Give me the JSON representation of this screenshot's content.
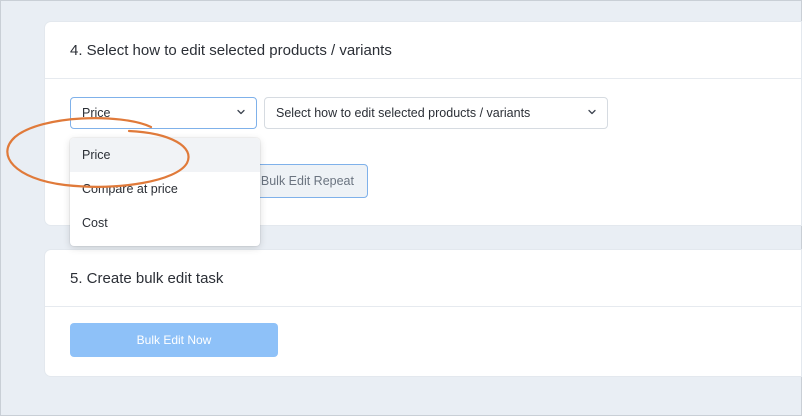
{
  "step4": {
    "title": "4. Select how to edit selected products / variants",
    "field_select_value": "Price",
    "mode_select_placeholder": "Select how to edit selected products / variants",
    "repeat_button_label": "e Bulk Edit Repeat",
    "dropdown_options": [
      "Price",
      "Compare at price",
      "Cost"
    ],
    "dropdown_selected_index": 0
  },
  "step5": {
    "title": "5. Create bulk edit task",
    "bulk_edit_button_label": "Bulk Edit Now"
  },
  "annotation": {
    "ring_color": "#e07a3a",
    "shape": "ellipse-highlight"
  },
  "colors": {
    "accent": "#8ec1f8",
    "focus_border": "#7fb1ea",
    "background": "#e9eef4"
  }
}
